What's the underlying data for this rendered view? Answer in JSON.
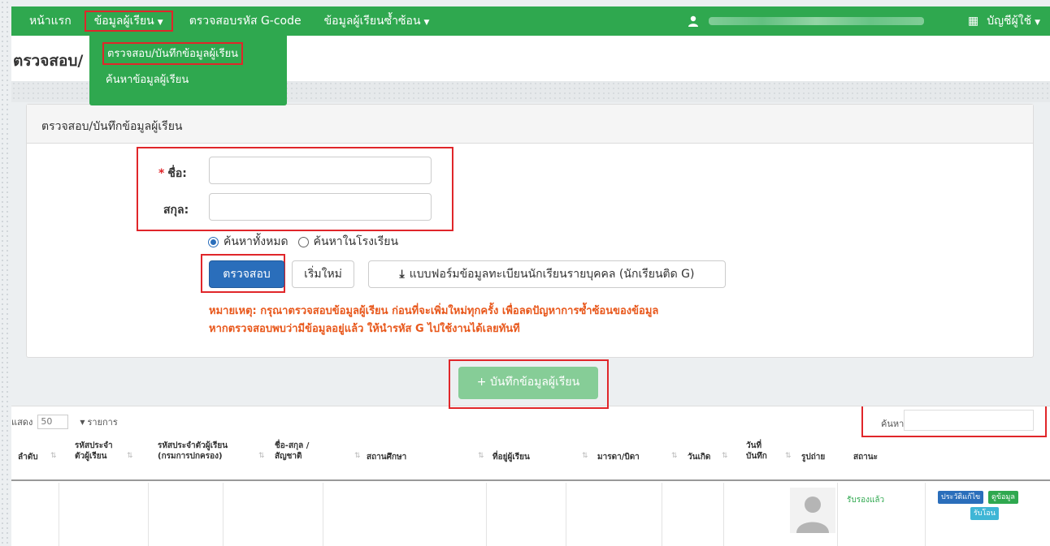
{
  "navbar": {
    "home": "หน้าแรก",
    "student_info": "ข้อมูลผู้เรียน",
    "gcode_check": "ตรวจสอบรหัส G-code",
    "duplicate": "ข้อมูลผู้เรียนซ้ำซ้อน",
    "account": "บัญชีผู้ใช้"
  },
  "dropdown": {
    "check_record": "ตรวจสอบ/บันทึกข้อมูลผู้เรียน",
    "search": "ค้นหาข้อมูลผู้เรียน"
  },
  "page": {
    "title": "ตรวจสอบ/"
  },
  "panel": {
    "heading": "ตรวจสอบ/บันทึกข้อมูลผู้เรียน",
    "required_mark": "*",
    "first_name_label": "ชื่อ:",
    "last_name_label": "สกุล:",
    "first_name_value": "",
    "last_name_value": "",
    "radio_all": "ค้นหาทั้งหมด",
    "radio_school": "ค้นหาในโรงเรียน",
    "btn_check": "ตรวจสอบ",
    "btn_reset": "เริ่มใหม่",
    "btn_form": "แบบฟอร์มข้อมูลทะเบียนนักเรียนรายบุคคล (นักเรียนติด G)",
    "note_line1": "หมายเหตุ: กรุณาตรวจสอบข้อมูลผู้เรียน ก่อนที่จะเพิ่มใหม่ทุกครั้ง เพื่อลดปัญหาการซ้ำซ้อนของข้อมูล",
    "note_line2": "หากตรวจสอบพบว่ามีข้อมูลอยู่แล้ว ให้นำรหัส G ไปใช้งานได้เลยทันที"
  },
  "save_button": "+ บันทึกข้อมูลผู้เรียน",
  "table": {
    "show_label": "แสดง",
    "page_length": "50",
    "entries_label": "รายการ",
    "search_label": "ค้นหา:",
    "headers": [
      "ลำดับ",
      "รหัสประจำ ตัวผู้เรียน",
      "รหัสประจำตัวผู้เรียน (กรมการปกครอง)",
      "ชื่อ-สกุล / สัญชาติ",
      "สถานศึกษา",
      "ที่อยู่ผู้เรียน",
      "มารดา/บิดา",
      "วันเกิด",
      "วันที่ บันทึก",
      "รูปถ่าย",
      "สถานะ"
    ],
    "row": {
      "status": "รับรองแล้ว",
      "btn_history": "ประวัติแก้ไข",
      "btn_view": "ดูข้อมูล",
      "btn_transfer": "รับโอน"
    }
  },
  "colors": {
    "navbar": "#2fa84f",
    "primary": "#2a6ebb",
    "highlight": "#e0262a",
    "note": "#e8581c",
    "save_button": "#86cd97"
  }
}
